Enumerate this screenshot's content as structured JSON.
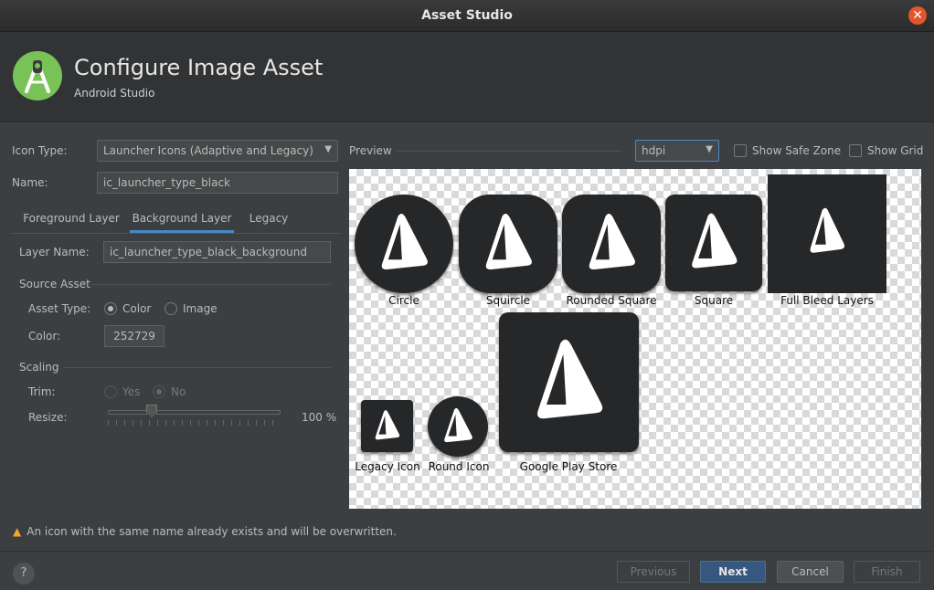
{
  "window": {
    "title": "Asset Studio"
  },
  "header": {
    "title": "Configure Image Asset",
    "subtitle": "Android Studio"
  },
  "form": {
    "icon_type_label": "Icon Type:",
    "icon_type_value": "Launcher Icons (Adaptive and Legacy)",
    "name_label": "Name:",
    "name_value": "ic_launcher_type_black"
  },
  "tabs": [
    {
      "label": "Foreground Layer"
    },
    {
      "label": "Background Layer"
    },
    {
      "label": "Legacy"
    }
  ],
  "active_tab": "Background Layer",
  "layer": {
    "layer_name_label": "Layer Name:",
    "layer_name_value": "ic_launcher_type_black_background",
    "source_asset_heading": "Source Asset",
    "asset_type_label": "Asset Type:",
    "asset_type_options": [
      "Color",
      "Image"
    ],
    "asset_type_selected": "Color",
    "color_label": "Color:",
    "color_value": "252729",
    "scaling_heading": "Scaling",
    "trim_label": "Trim:",
    "trim_options": [
      "Yes",
      "No"
    ],
    "trim_selected": "No",
    "resize_label": "Resize:",
    "resize_value": "100 %"
  },
  "preview": {
    "label": "Preview",
    "density_value": "hdpi",
    "show_safe_zone_label": "Show Safe Zone",
    "show_grid_label": "Show Grid",
    "icons": [
      "Circle",
      "Squircle",
      "Rounded Square",
      "Square",
      "Full Bleed Layers",
      "Legacy Icon",
      "Round Icon",
      "Google Play Store"
    ],
    "icon_background_color": "#252729"
  },
  "warning": "An icon with the same name already exists and will be overwritten.",
  "footer": {
    "help_label": "?",
    "previous_label": "Previous",
    "next_label": "Next",
    "cancel_label": "Cancel",
    "finish_label": "Finish"
  },
  "colors": {
    "accent": "#4a88c7",
    "primary_button": "#365880",
    "warning": "#f0a732",
    "close": "#e4552c"
  }
}
